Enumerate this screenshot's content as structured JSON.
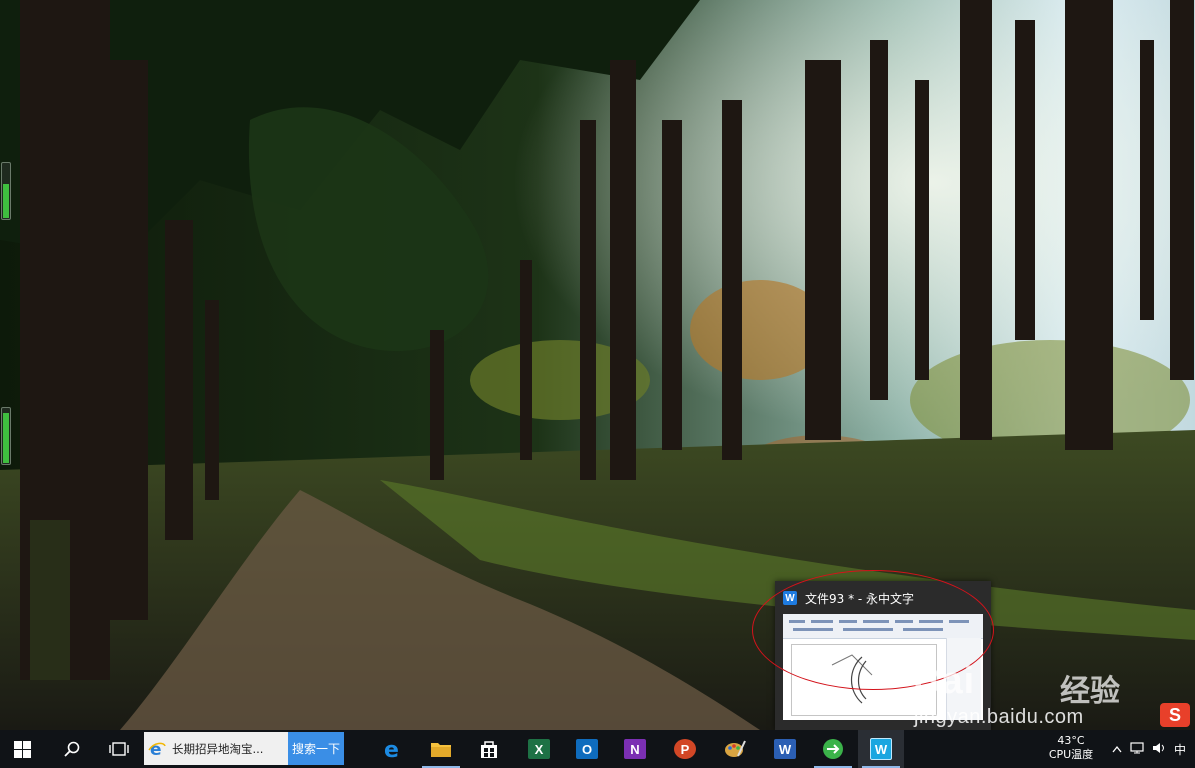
{
  "desktop": {
    "wallpaper": "forest-path-photo"
  },
  "preview": {
    "title": "文件93 * - 永中文字",
    "app_icon": "yozo-writer-icon"
  },
  "search": {
    "text": "长期招异地淘宝...",
    "button_label": "搜索一下"
  },
  "taskbar": {
    "start_icon": "windows-logo-icon",
    "cortana_icon": "search-icon",
    "taskview_icon": "task-view-icon",
    "apps": [
      {
        "name": "edge",
        "label": "e",
        "color": "#1c8be3"
      },
      {
        "name": "file-explorer",
        "label": "",
        "color": "#f5c13d"
      },
      {
        "name": "store",
        "label": "",
        "color": "#ffffff"
      },
      {
        "name": "excel",
        "label": "X",
        "color": "#1e7145"
      },
      {
        "name": "outlook",
        "label": "O",
        "color": "#0f6cbd"
      },
      {
        "name": "onenote",
        "label": "N",
        "color": "#7b2fb3"
      },
      {
        "name": "powerpoint",
        "label": "P",
        "color": "#d24726"
      },
      {
        "name": "paint",
        "label": "",
        "color": "#d9a441"
      },
      {
        "name": "word",
        "label": "W",
        "color": "#2b5fb4"
      },
      {
        "name": "browser",
        "label": "",
        "color": "#3bb34a"
      },
      {
        "name": "yozo-writer",
        "label": "W",
        "color": "#1aa6e0"
      }
    ]
  },
  "tray": {
    "temp": "43°C",
    "cpu_label": "CPU温度",
    "ime_label": "中"
  },
  "watermark": {
    "brand": "Bai",
    "brand2": "经验",
    "url": "jingyan.baidu.com",
    "sogou": "S"
  },
  "colors": {
    "annotation": "#d3131b",
    "search_button": "#3a8ee6"
  }
}
